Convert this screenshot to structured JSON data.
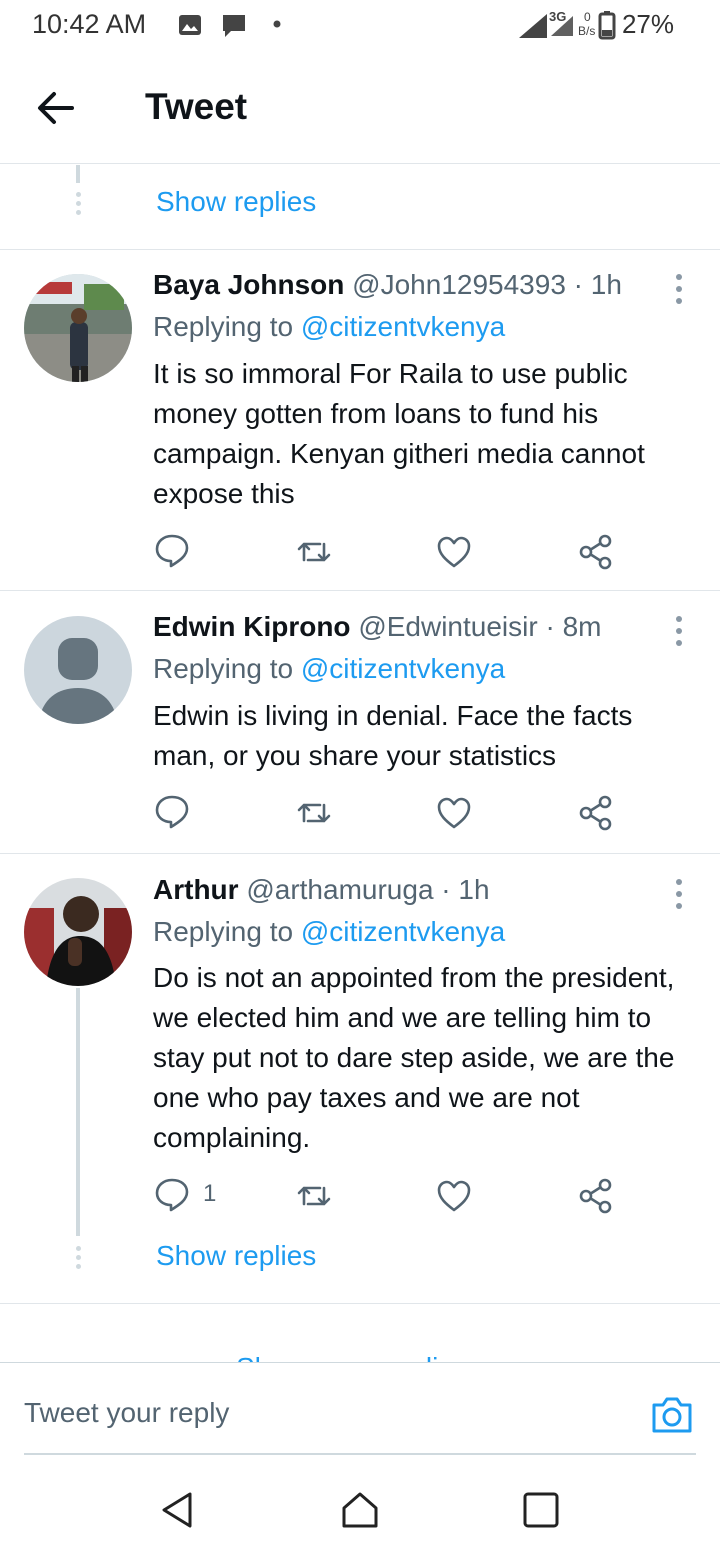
{
  "status_bar": {
    "time": "10:42 AM",
    "net_type": "3G",
    "net_speed": "0",
    "net_unit": "B/s",
    "battery": "27%"
  },
  "header": {
    "title": "Tweet"
  },
  "thread_top": {
    "show_replies": "Show replies"
  },
  "tweets": [
    {
      "name": "Baya Johnson",
      "handle": "@John12954393",
      "sep": "·",
      "time": "1h",
      "replying_prefix": "Replying to",
      "mention": "@citizentvkenya",
      "body": "It is so immoral For Raila to use public money gotten from loans to fund his campaign. Kenyan githeri media cannot expose this",
      "reply_count": ""
    },
    {
      "name": "Edwin Kiprono",
      "handle": "@Edwintueisir",
      "sep": "·",
      "time": "8m",
      "replying_prefix": "Replying to",
      "mention": "@citizentvkenya",
      "body": "Edwin is living in denial. Face the facts man, or you share your statistics",
      "reply_count": ""
    },
    {
      "name": "Arthur",
      "handle": "@arthamuruga",
      "sep": "·",
      "time": "1h",
      "replying_prefix": "Replying to",
      "mention": "@citizentvkenya",
      "body": "Do is not an appointed from the president, we elected him and we are telling him to stay put not to dare step aside, we are the one who pay taxes and we are not complaining.",
      "reply_count": "1",
      "show_replies": "Show replies"
    }
  ],
  "show_more": "Show more replies",
  "reply_bar": {
    "placeholder": "Tweet your reply"
  },
  "icons": {
    "back": "arrow-left-icon",
    "reply": "speech-bubble-icon",
    "retweet": "retweet-icon",
    "like": "heart-icon",
    "share": "share-icon",
    "camera": "camera-icon",
    "nav_back": "triangle-back-icon",
    "nav_home": "home-icon",
    "nav_recents": "square-recents-icon"
  },
  "colors": {
    "accent": "#1d9bf0",
    "muted": "#536471",
    "text": "#0f1419",
    "divider": "#e1e6ea"
  }
}
